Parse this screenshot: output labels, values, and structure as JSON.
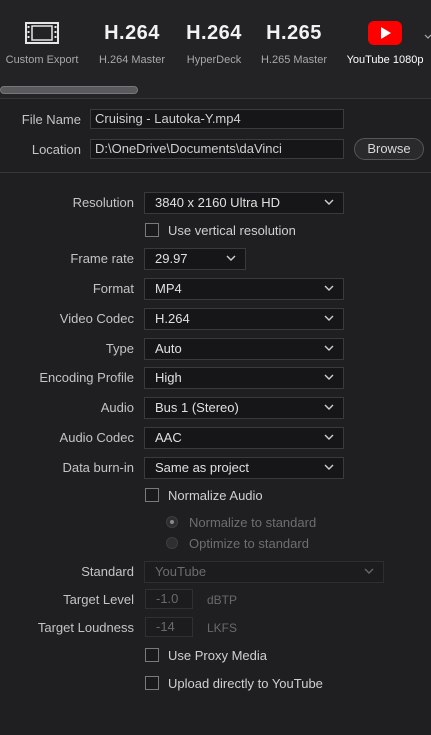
{
  "presets": [
    {
      "label": "Custom Export",
      "icon": "film-strip-icon",
      "codec": ""
    },
    {
      "label": "H.264 Master",
      "icon": "",
      "codec": "H.264"
    },
    {
      "label": "HyperDeck",
      "icon": "",
      "codec": "H.264"
    },
    {
      "label": "H.265 Master",
      "icon": "",
      "codec": "H.265"
    },
    {
      "label": "YouTube 1080p",
      "icon": "youtube-icon",
      "codec": ""
    }
  ],
  "file": {
    "name_label": "File Name",
    "name_value": "Cruising - Lautoka-Y.mp4",
    "location_label": "Location",
    "location_value": "D:\\OneDrive\\Documents\\daVinci",
    "browse_label": "Browse"
  },
  "settings": {
    "resolution_label": "Resolution",
    "resolution_value": "3840 x 2160 Ultra HD",
    "vertical_label": "Use vertical resolution",
    "framerate_label": "Frame rate",
    "framerate_value": "29.97",
    "format_label": "Format",
    "format_value": "MP4",
    "videocodec_label": "Video Codec",
    "videocodec_value": "H.264",
    "type_label": "Type",
    "type_value": "Auto",
    "profile_label": "Encoding Profile",
    "profile_value": "High",
    "audio_label": "Audio",
    "audio_value": "Bus 1 (Stereo)",
    "audiocodec_label": "Audio Codec",
    "audiocodec_value": "AAC",
    "burnin_label": "Data burn-in",
    "burnin_value": "Same as project",
    "normalize_label": "Normalize Audio",
    "radio1_label": "Normalize to standard",
    "radio2_label": "Optimize to standard",
    "standard_label": "Standard",
    "standard_value": "YouTube",
    "targetlevel_label": "Target Level",
    "targetlevel_value": "-1.0",
    "targetlevel_unit": "dBTP",
    "targetloud_label": "Target Loudness",
    "targetloud_value": "-14",
    "targetloud_unit": "LKFS",
    "proxy_label": "Use Proxy Media",
    "upload_label": "Upload directly to YouTube"
  },
  "colors": {
    "youtube_red": "#ff0000",
    "background": "#1f1f22"
  }
}
